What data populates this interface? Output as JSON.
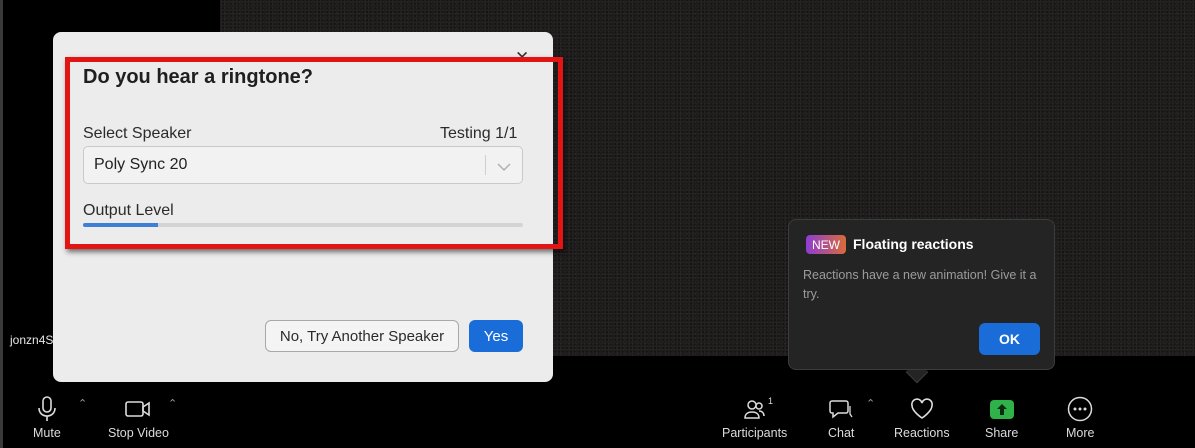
{
  "video": {
    "participant_name": "jonzn4S"
  },
  "dialog": {
    "title": "Do you hear a ringtone?",
    "select_speaker_label": "Select Speaker",
    "testing_status": "Testing 1/1",
    "speaker_selected": "Poly Sync 20",
    "output_level_label": "Output Level",
    "output_level": 0.17,
    "no_button": "No, Try Another Speaker",
    "yes_button": "Yes"
  },
  "tooltip": {
    "badge": "NEW",
    "title": "Floating reactions",
    "body": "Reactions have a new animation! Give it a try.",
    "ok_button": "OK"
  },
  "toolbar": {
    "mute": "Mute",
    "stop_video": "Stop Video",
    "participants": "Participants",
    "participants_count": "1",
    "chat": "Chat",
    "reactions": "Reactions",
    "share": "Share",
    "more": "More"
  },
  "colors": {
    "accent": "#1a6dd8",
    "highlight": "#e21414",
    "share": "#2fb24a",
    "meter_fill": "#3f7fd6"
  }
}
